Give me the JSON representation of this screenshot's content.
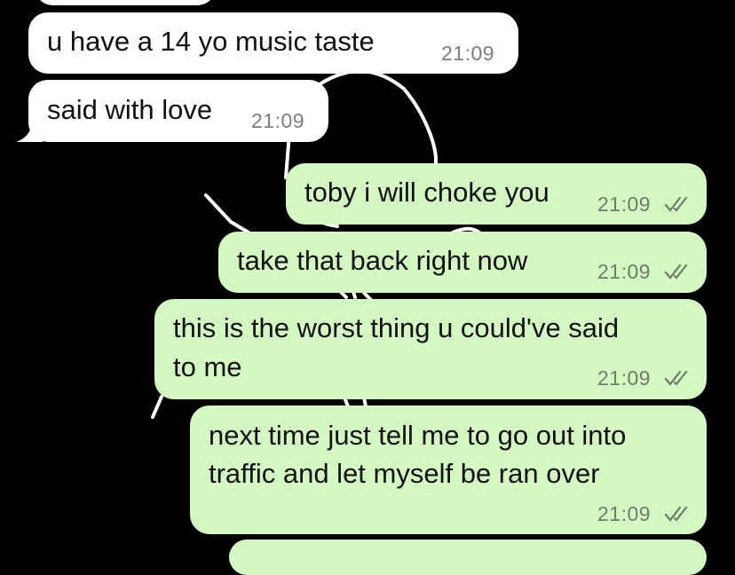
{
  "colors": {
    "background": "#000000",
    "incoming_bubble": "#ffffff",
    "outgoing_bubble": "#d4f8c2",
    "timestamp": "#7d7d7d",
    "read_receipt": "#6d7d6a"
  },
  "messages": [
    {
      "direction": "incoming",
      "text": "u have a 14 yo music taste",
      "time": "21:09"
    },
    {
      "direction": "incoming",
      "text": "said with love",
      "time": "21:09"
    },
    {
      "direction": "outgoing",
      "text": "toby i will choke you",
      "time": "21:09",
      "status_icon": "double-check-icon"
    },
    {
      "direction": "outgoing",
      "text": "take that back right now",
      "time": "21:09",
      "status_icon": "double-check-icon"
    },
    {
      "direction": "outgoing",
      "lines": [
        "this is the worst thing u could've said",
        "to me"
      ],
      "time": "21:09",
      "status_icon": "double-check-icon"
    },
    {
      "direction": "outgoing",
      "lines": [
        "next time just tell me to go out into",
        "traffic and let myself be ran over"
      ],
      "time": "21:09",
      "status_icon": "double-check-icon"
    }
  ]
}
